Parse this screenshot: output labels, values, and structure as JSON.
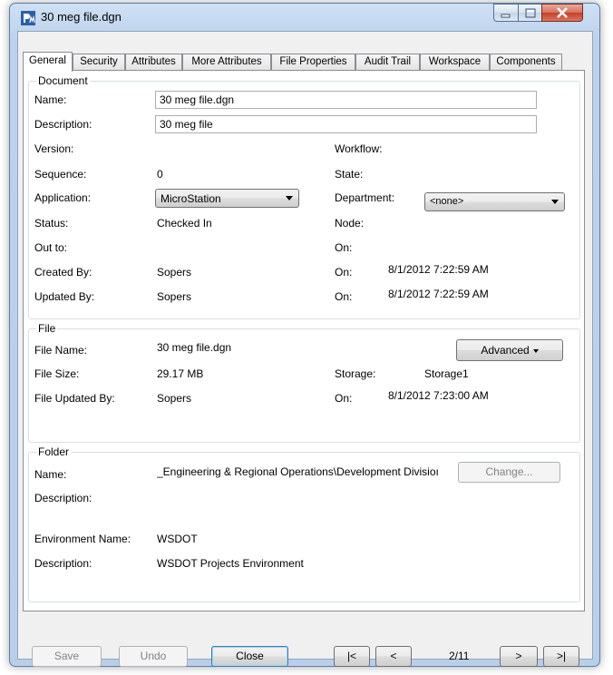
{
  "window": {
    "title": "30 meg file.dgn"
  },
  "tabs": [
    "General",
    "Security",
    "Attributes",
    "More Attributes",
    "File Properties",
    "Audit Trail",
    "Workspace",
    "Components"
  ],
  "document": {
    "legend": "Document",
    "name_label": "Name:",
    "name_value": "30 meg file.dgn",
    "description_label": "Description:",
    "description_value": "30 meg file",
    "version_label": "Version:",
    "workflow_label": "Workflow:",
    "sequence_label": "Sequence:",
    "sequence_value": "0",
    "state_label": "State:",
    "application_label": "Application:",
    "application_value": "MicroStation",
    "department_label": "Department:",
    "department_value": "<none>",
    "status_label": "Status:",
    "status_value": "Checked In",
    "node_label": "Node:",
    "out_to_label": "Out to:",
    "on_label": "On:",
    "created_by_label": "Created By:",
    "created_by_value": "Sopers",
    "created_on_label": "On:",
    "created_on_value": "8/1/2012 7:22:59 AM",
    "updated_by_label": "Updated By:",
    "updated_by_value": "Sopers",
    "updated_on_label": "On:",
    "updated_on_value": "8/1/2012 7:22:59 AM"
  },
  "file": {
    "legend": "File",
    "file_name_label": "File Name:",
    "file_name_value": "30 meg file.dgn",
    "advanced_button": "Advanced",
    "file_size_label": "File Size:",
    "file_size_value": "29.17 MB",
    "storage_label": "Storage:",
    "storage_value": "Storage1",
    "file_updated_by_label": "File Updated By:",
    "file_updated_by_value": "Sopers",
    "file_updated_on_label": "On:",
    "file_updated_on_value": "8/1/2012 7:23:00 AM"
  },
  "folder": {
    "legend": "Folder",
    "name_label": "Name:",
    "name_value": "_Engineering & Regional Operations\\Development Divisioı",
    "change_button": "Change...",
    "description_label": "Description:",
    "environment_name_label": "Environment Name:",
    "environment_name_value": "WSDOT",
    "env_description_label": "Description:",
    "env_description_value": "WSDOT Projects Environment"
  },
  "footer": {
    "save": "Save",
    "undo": "Undo",
    "close": "Close",
    "first": "|<",
    "prev": "<",
    "page": "2/11",
    "next": ">",
    "last": ">|"
  }
}
